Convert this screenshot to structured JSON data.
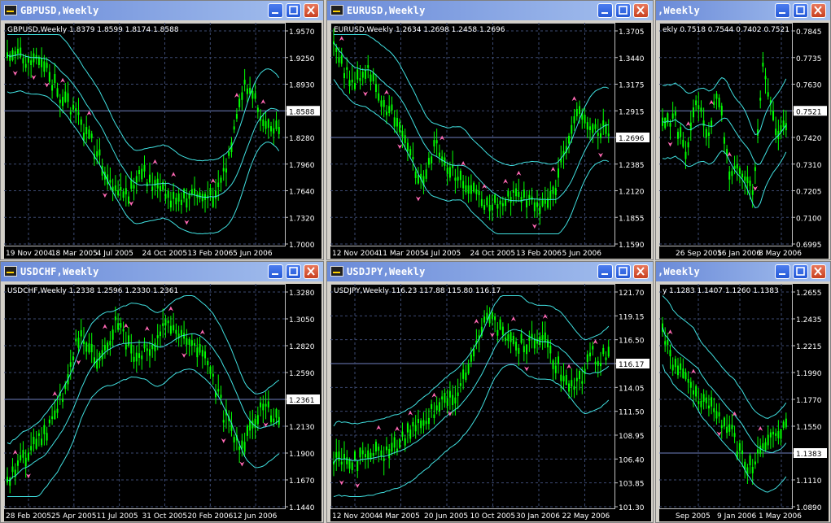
{
  "windows": [
    {
      "id": "gbpusd",
      "title": "GBPUSD,Weekly",
      "info": "GBPUSD,Weekly  1.8379 1.8599 1.8174 1.8588",
      "price_labels": [
        "1.9570",
        "1.9250",
        "1.8930",
        "1.8588",
        "1.8280",
        "1.7960",
        "1.7640",
        "1.7320",
        "1.7000"
      ],
      "current_price": "1.8588",
      "date_labels": [
        "19 Nov 2004",
        "18 Mar 2005",
        "4 Jul 2005",
        "24 Oct 2005",
        "13 Feb 2006",
        "5 Jun 2006"
      ]
    },
    {
      "id": "eurusd",
      "title": "EURUSD,Weekly",
      "info": "EURUSD,Weekly  1.2634 1.2698 1.2458 1.2696",
      "price_labels": [
        "1.3705",
        "1.3440",
        "1.3175",
        "1.2915",
        "1.2696",
        "1.2385",
        "1.2120",
        "1.1855",
        "1.1590"
      ],
      "current_price": "1.2696",
      "date_labels": [
        "12 Nov 2004",
        "11 Mar 2005",
        "4 Jul 2005",
        "24 Oct 2005",
        "13 Feb 2006",
        "5 Jun 2006"
      ]
    },
    {
      "id": "usdgbp-partial",
      "title": ",Weekly",
      "info": "ekly  0.7518 0.7544 0.7402 0.7521",
      "price_labels": [
        "0.7845",
        "0.7735",
        "0.7630",
        "0.7521",
        "0.7420",
        "0.7310",
        "0.7205",
        "0.7100",
        "0.6995"
      ],
      "current_price": "0.7521",
      "date_labels": [
        "26 Sep 2005",
        "16 Jan 2006",
        "8 May 2006"
      ]
    },
    {
      "id": "usdchf",
      "title": "USDCHF,Weekly",
      "info": "USDCHF,Weekly  1.2338 1.2596 1.2330 1.2361",
      "price_labels": [
        "1.3280",
        "1.3050",
        "1.2820",
        "1.2590",
        "1.2361",
        "1.2130",
        "1.1900",
        "1.1670",
        "1.1440"
      ],
      "current_price": "1.2361",
      "date_labels": [
        "28 Feb 2005",
        "25 Apr 2005",
        "11 Jul 2005",
        "31 Oct 2005",
        "20 Feb 2006",
        "12 Jun 2006"
      ]
    },
    {
      "id": "usdjpy",
      "title": "USDJPY,Weekly",
      "info": "USDJPY,Weekly  116.23 117.88 115.80 116.17",
      "price_labels": [
        "121.70",
        "119.15",
        "116.50",
        "116.17",
        "114.05",
        "111.50",
        "108.95",
        "106.40",
        "103.85",
        "101.30"
      ],
      "current_price": "116.17",
      "date_labels": [
        "12 Nov 2004",
        "4 Mar 2005",
        "20 Jun 2005",
        "10 Oct 2005",
        "30 Jan 2006",
        "22 May 2006"
      ]
    },
    {
      "id": "usdcad-partial",
      "title": ",Weekly",
      "info": "y  1.1283 1.1407 1.1260 1.1383",
      "price_labels": [
        "1.2655",
        "1.2435",
        "1.2215",
        "1.1990",
        "1.1770",
        "1.1550",
        "1.1383",
        "1.1110",
        "1.0890"
      ],
      "current_price": "1.1383",
      "date_labels": [
        "Sep 2005",
        "9 Jan 2006",
        "1 May 2006"
      ]
    }
  ],
  "colors": {
    "chart_bg": "#000000",
    "candles": "#00ff00",
    "bands": "#40e0e0",
    "fractals": "#ff69b4",
    "grid": "#3c4a72",
    "axis_text": "#ffffff"
  },
  "icons": [
    "chart-window-icon",
    "minimize-icon",
    "maximize-icon",
    "close-icon"
  ]
}
